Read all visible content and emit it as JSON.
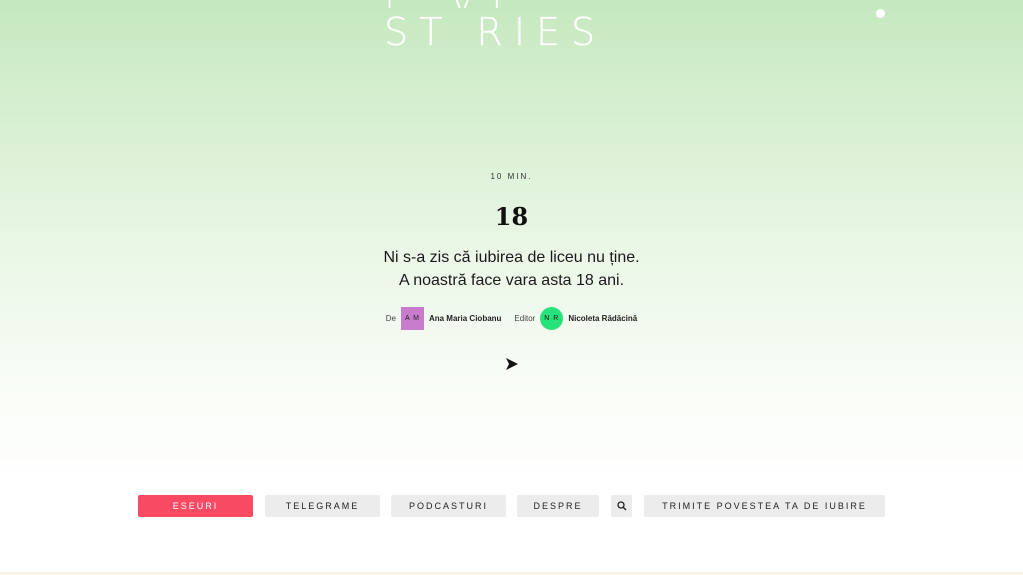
{
  "logo": {
    "line1": "L VE",
    "line2": "ST RIES"
  },
  "story": {
    "duration": "10 MIN.",
    "title": "18",
    "subtitle_line1": "Ni s-a zis că iubirea de liceu nu ține.",
    "subtitle_line2": "A noastră face vara asta 18 ani."
  },
  "credits": {
    "author_label": "De",
    "author_initials": "A M",
    "author_name": "Ana Maria Ciobanu",
    "editor_label": "Editor",
    "editor_initials": "N R",
    "editor_name": "Nicoleta Rădăcină"
  },
  "nav": {
    "eseuri": "ESEURI",
    "telegrame": "TELEGRAME",
    "podcasturi": "PODCASTURI",
    "despre": "DESPRE",
    "trimite": "TRIMITE POVESTEA TA DE IUBIRE"
  },
  "icons": {
    "search": "search-icon",
    "play": "play-icon"
  },
  "colors": {
    "active_nav": "#f84b63",
    "author_avatar": "#c77dcb",
    "editor_avatar": "#27e27a",
    "nav_button": "#ececec"
  }
}
